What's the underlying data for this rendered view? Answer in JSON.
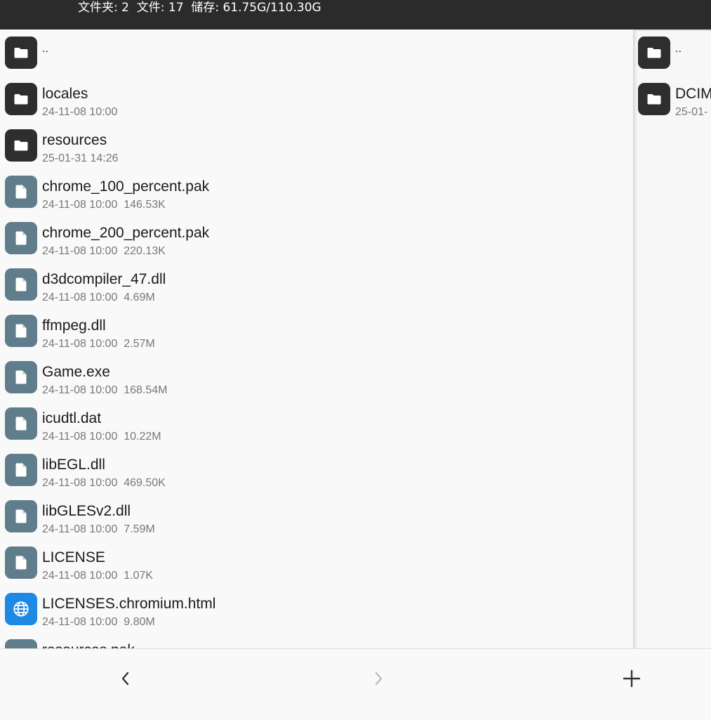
{
  "status": {
    "text": "文件夹: 2  文件: 17  储存: 61.75G/110.30G"
  },
  "left_pane": {
    "items": [
      {
        "type": "folder",
        "name": "..",
        "meta": ""
      },
      {
        "type": "folder",
        "name": "locales",
        "meta": "24-11-08 10:00"
      },
      {
        "type": "folder",
        "name": "resources",
        "meta": "25-01-31 14:26"
      },
      {
        "type": "file",
        "name": "chrome_100_percent.pak",
        "meta": "24-11-08 10:00  146.53K"
      },
      {
        "type": "file",
        "name": "chrome_200_percent.pak",
        "meta": "24-11-08 10:00  220.13K"
      },
      {
        "type": "file",
        "name": "d3dcompiler_47.dll",
        "meta": "24-11-08 10:00  4.69M"
      },
      {
        "type": "file",
        "name": "ffmpeg.dll",
        "meta": "24-11-08 10:00  2.57M"
      },
      {
        "type": "file",
        "name": "Game.exe",
        "meta": "24-11-08 10:00  168.54M"
      },
      {
        "type": "file",
        "name": "icudtl.dat",
        "meta": "24-11-08 10:00  10.22M"
      },
      {
        "type": "file",
        "name": "libEGL.dll",
        "meta": "24-11-08 10:00  469.50K"
      },
      {
        "type": "file",
        "name": "libGLESv2.dll",
        "meta": "24-11-08 10:00  7.59M"
      },
      {
        "type": "file",
        "name": "LICENSE",
        "meta": "24-11-08 10:00  1.07K"
      },
      {
        "type": "html",
        "name": "LICENSES.chromium.html",
        "meta": "24-11-08 10:00  9.80M"
      },
      {
        "type": "file",
        "name": "resources.pak",
        "meta": ""
      }
    ]
  },
  "right_pane": {
    "items": [
      {
        "type": "folder",
        "name": "..",
        "meta": ""
      },
      {
        "type": "folder",
        "name": "DCIM",
        "meta": "25-01-"
      }
    ]
  },
  "bottom_bar": {
    "back_icon": "chevron-left-icon",
    "forward_icon": "chevron-right-icon",
    "add_icon": "plus-icon"
  },
  "colors": {
    "status_bar": "#2b2b2b",
    "folder_icon_bg": "#2e2e2e",
    "file_icon_bg": "#607d8b",
    "html_icon_bg": "#1e88e5"
  }
}
